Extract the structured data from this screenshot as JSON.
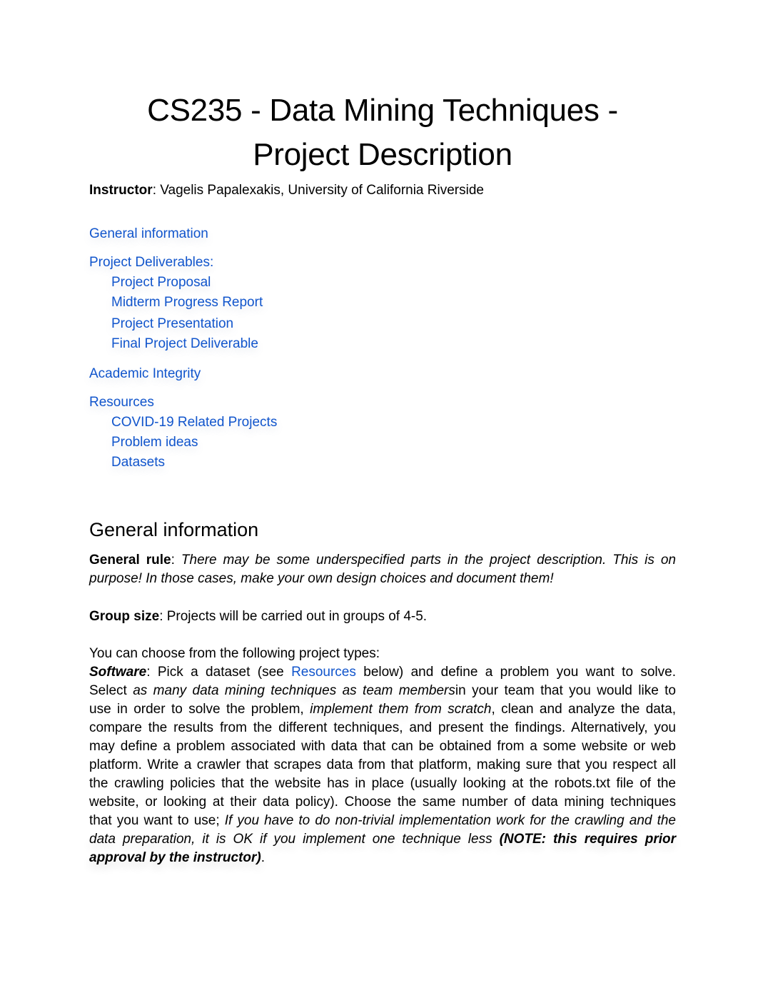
{
  "document": {
    "title_line1": "CS235 - Data Mining Techniques -",
    "title_line2": "Project Description",
    "instructor_label": "Instructor",
    "instructor_value": ": Vagelis Papalexakis, University of California Riverside"
  },
  "toc": {
    "link_color": "#1155cc",
    "items": [
      {
        "label": "General information",
        "level": 1
      },
      {
        "label": "Project Deliverables:",
        "level": 1
      },
      {
        "label": "Project Proposal",
        "level": 2
      },
      {
        "label": "Midterm Progress Report",
        "level": 2
      },
      {
        "label": "Project Presentation",
        "level": 2
      },
      {
        "label": "Final Project Deliverable",
        "level": 2
      },
      {
        "label": "Academic Integrity",
        "level": 1
      },
      {
        "label": "Resources",
        "level": 1
      },
      {
        "label": "COVID-19 Related Projects",
        "level": 2
      },
      {
        "label": "Problem ideas",
        "level": 2
      },
      {
        "label": "Datasets",
        "level": 2
      }
    ]
  },
  "general_information": {
    "heading": "General information",
    "general_rule_label": "General rule",
    "general_rule_sep": ": ",
    "general_rule_text_line1": "There may be some underspecified parts in the project description. This is on",
    "general_rule_text_line2": "purpose! In those cases, make your own design choices and document them!",
    "group_size_label": "Group size",
    "group_size_text": ": Projects will be carried out in groups of 4-5.",
    "project_types_intro": "You can choose from the following project types:",
    "software": {
      "label": "Software",
      "line1_a": ":  Pick a dataset (see ",
      "line1_link": "Resources",
      "line1_b": " below) and define a problem you want to solve.",
      "line2_a": "Select ",
      "line2_italic": "as many data mining techniques as team members",
      "line2_b": "in your team that you would like to",
      "line3_a": "use in order to solve the problem, ",
      "line3_italic": "implement them from scratch",
      "line3_b": ", clean and analyze the data,",
      "line4": "compare the results from the different techniques, and present the findings. Alternatively, you",
      "line5": "may define a problem associated with data that can be obtained from a some website or web",
      "line6": "platform. Write a crawler that scrapes data from that platform, making sure that you respect all",
      "line7": "the crawling policies that the website has in place (usually looking at the robots.txt file of the",
      "line8": "website, or looking at their data policy). Choose the same number of data mining techniques",
      "line9_a": "that you want to use; ",
      "line9_italic": "If you have to do non-trivial implementation work for the crawling and the",
      "line10_italic": "data preparation, it is OK if you implement one technique less ",
      "line10_bold": "(NOTE: this requires prior",
      "line11_bold": "approval by the instructor)",
      "line11_end": "."
    }
  }
}
